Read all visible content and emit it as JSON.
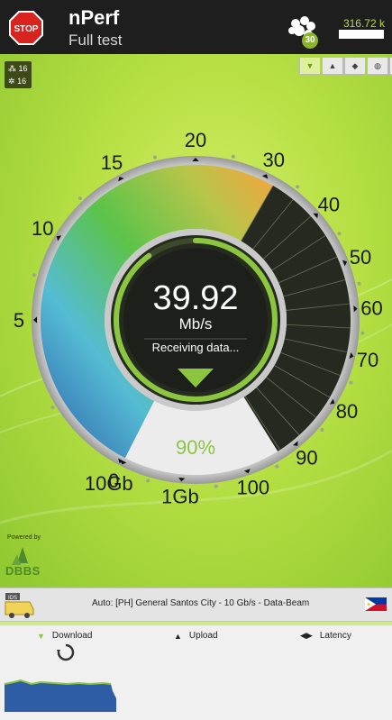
{
  "header": {
    "stop_label": "STOP",
    "app_name": "nPerf",
    "subtitle": "Full test",
    "server_count": "30",
    "data_used": "316.72 k"
  },
  "stats": {
    "up_count": "16",
    "down_count": "16"
  },
  "view_buttons": [
    {
      "icon": "download-icon",
      "glyph": "▼"
    },
    {
      "icon": "upload-icon",
      "glyph": "▲"
    },
    {
      "icon": "latency-icon",
      "glyph": "◆"
    },
    {
      "icon": "globe-icon",
      "glyph": "◍"
    },
    {
      "icon": "fullscreen-icon",
      "glyph": "⊡"
    }
  ],
  "gauge": {
    "scale_labels": [
      "0",
      "5",
      "10",
      "15",
      "20",
      "30",
      "40",
      "50",
      "60",
      "70",
      "80",
      "90",
      "100",
      "1Gb",
      "10Gb"
    ],
    "speed_value": "39.92",
    "speed_unit": "Mb/s",
    "status": "Receiving data...",
    "progress_label": "90%",
    "progress_fraction": 0.9,
    "colors": {
      "low": "#3a6eb0",
      "mid": "#5bc445",
      "high": "#f3a33a",
      "accent": "#8cc63f",
      "dark": "#222"
    }
  },
  "branding": {
    "powered_by": "Powered by",
    "logo_text": "DBBS"
  },
  "server": {
    "description": "Auto: [PH] General Santos City - 10 Gb/s - Data-Beam",
    "badge": "IDS"
  },
  "results": {
    "tabs": [
      {
        "label": "Download",
        "icon": "download-icon"
      },
      {
        "label": "Upload",
        "icon": "upload-icon"
      },
      {
        "label": "Latency",
        "icon": "latency-icon"
      }
    ]
  }
}
